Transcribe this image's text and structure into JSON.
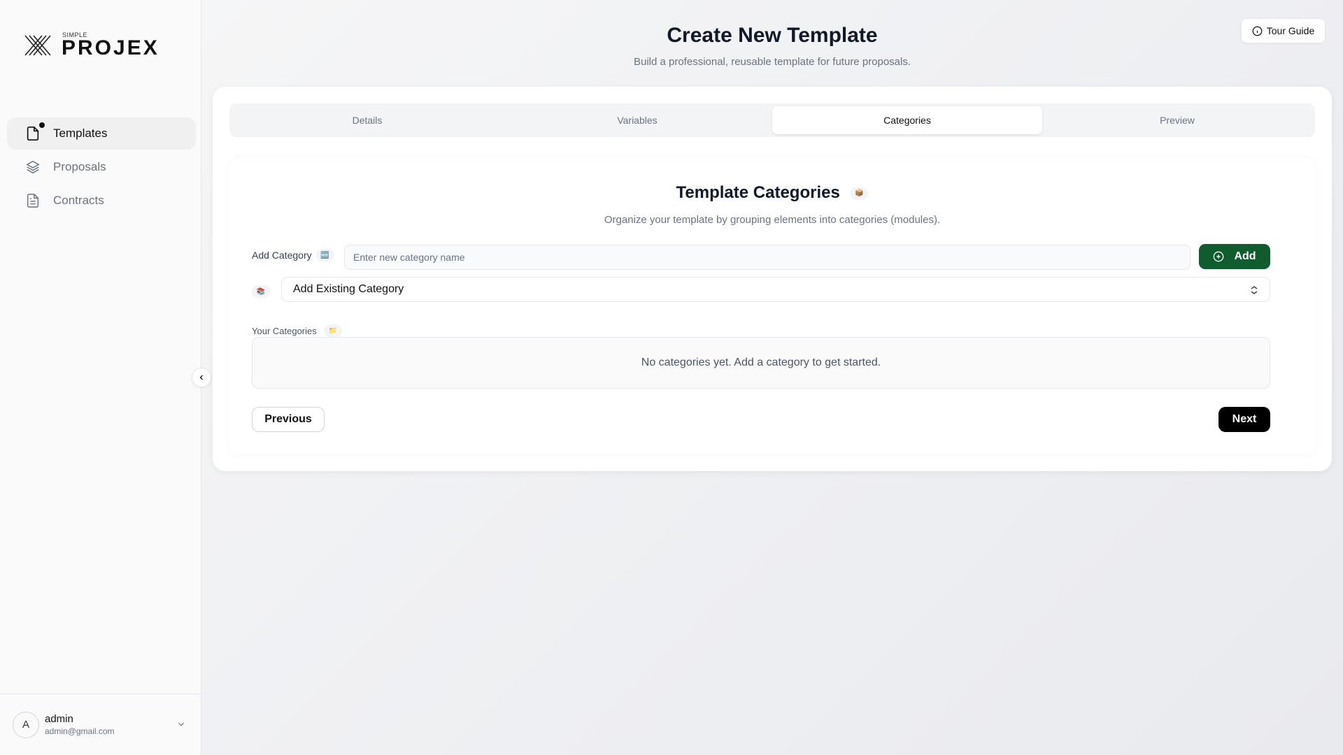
{
  "brand": {
    "small": "SIMPLE",
    "name": "PROJEX"
  },
  "sidebar": {
    "items": [
      {
        "label": "Templates",
        "icon": "file-icon",
        "active": true
      },
      {
        "label": "Proposals",
        "icon": "layers-icon",
        "active": false
      },
      {
        "label": "Contracts",
        "icon": "document-icon",
        "active": false
      }
    ],
    "user": {
      "initial": "A",
      "name": "admin",
      "email": "admin@gmail.com"
    }
  },
  "header": {
    "title": "Create New Template",
    "subtitle": "Build a professional, reusable template for future proposals.",
    "tour_label": "Tour Guide"
  },
  "tabs": [
    {
      "label": "Details",
      "active": false
    },
    {
      "label": "Variables",
      "active": false
    },
    {
      "label": "Categories",
      "active": true
    },
    {
      "label": "Preview",
      "active": false
    }
  ],
  "categories": {
    "title": "Template Categories",
    "subtitle": "Organize your template by grouping elements into categories (modules).",
    "add_label": "Add Category",
    "input_placeholder": "Enter new category name",
    "add_button": "Add",
    "existing_label": "Add Existing Category",
    "your_label": "Your Categories",
    "empty_text": "No categories yet. Add a category to get started."
  },
  "footer": {
    "previous": "Previous",
    "next": "Next"
  },
  "colors": {
    "accent_green": "#0f5c2e",
    "next_black": "#000000"
  }
}
